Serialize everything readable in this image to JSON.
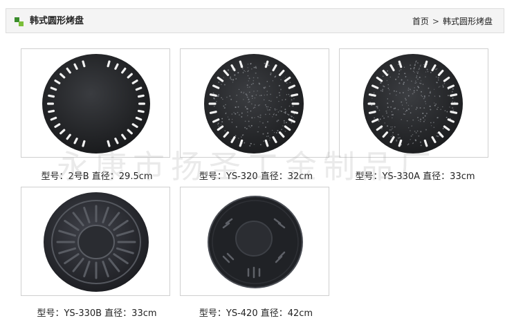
{
  "header": {
    "title": "韩式圆形烤盘",
    "breadcrumb": {
      "home": "首页",
      "separator": ">",
      "current": "韩式圆形烤盘"
    }
  },
  "products": [
    {
      "caption": "型号：2号B 直径：29.5cm",
      "style": "slotted-rough"
    },
    {
      "caption": "型号：YS-320 直径：32cm",
      "style": "slotted-speckled"
    },
    {
      "caption": "型号：YS-330A 直径：33cm",
      "style": "slotted-speckled"
    },
    {
      "caption": "型号：YS-330B 直径：33cm",
      "style": "sunburst"
    },
    {
      "caption": "型号：YS-420 直径：42cm",
      "style": "center-dome"
    }
  ],
  "watermark": "永康市扬圣工金制品厂",
  "colors": {
    "accent_green": "#3a8d2c",
    "plate": "#1f2124",
    "frame_border": "#cfcfcf"
  }
}
